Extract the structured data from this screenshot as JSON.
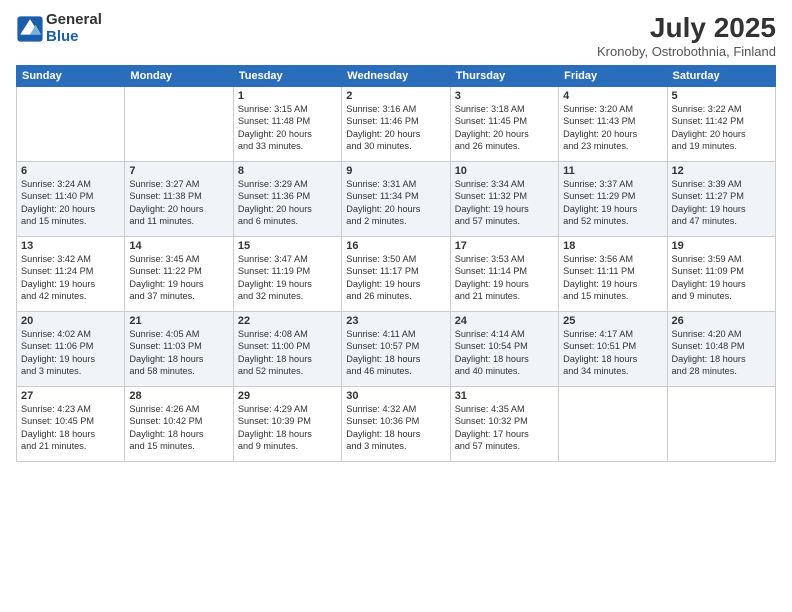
{
  "logo": {
    "general": "General",
    "blue": "Blue"
  },
  "title": "July 2025",
  "subtitle": "Kronoby, Ostrobothnia, Finland",
  "weekdays": [
    "Sunday",
    "Monday",
    "Tuesday",
    "Wednesday",
    "Thursday",
    "Friday",
    "Saturday"
  ],
  "weeks": [
    [
      {
        "day": "",
        "info": ""
      },
      {
        "day": "",
        "info": ""
      },
      {
        "day": "1",
        "info": "Sunrise: 3:15 AM\nSunset: 11:48 PM\nDaylight: 20 hours\nand 33 minutes."
      },
      {
        "day": "2",
        "info": "Sunrise: 3:16 AM\nSunset: 11:46 PM\nDaylight: 20 hours\nand 30 minutes."
      },
      {
        "day": "3",
        "info": "Sunrise: 3:18 AM\nSunset: 11:45 PM\nDaylight: 20 hours\nand 26 minutes."
      },
      {
        "day": "4",
        "info": "Sunrise: 3:20 AM\nSunset: 11:43 PM\nDaylight: 20 hours\nand 23 minutes."
      },
      {
        "day": "5",
        "info": "Sunrise: 3:22 AM\nSunset: 11:42 PM\nDaylight: 20 hours\nand 19 minutes."
      }
    ],
    [
      {
        "day": "6",
        "info": "Sunrise: 3:24 AM\nSunset: 11:40 PM\nDaylight: 20 hours\nand 15 minutes."
      },
      {
        "day": "7",
        "info": "Sunrise: 3:27 AM\nSunset: 11:38 PM\nDaylight: 20 hours\nand 11 minutes."
      },
      {
        "day": "8",
        "info": "Sunrise: 3:29 AM\nSunset: 11:36 PM\nDaylight: 20 hours\nand 6 minutes."
      },
      {
        "day": "9",
        "info": "Sunrise: 3:31 AM\nSunset: 11:34 PM\nDaylight: 20 hours\nand 2 minutes."
      },
      {
        "day": "10",
        "info": "Sunrise: 3:34 AM\nSunset: 11:32 PM\nDaylight: 19 hours\nand 57 minutes."
      },
      {
        "day": "11",
        "info": "Sunrise: 3:37 AM\nSunset: 11:29 PM\nDaylight: 19 hours\nand 52 minutes."
      },
      {
        "day": "12",
        "info": "Sunrise: 3:39 AM\nSunset: 11:27 PM\nDaylight: 19 hours\nand 47 minutes."
      }
    ],
    [
      {
        "day": "13",
        "info": "Sunrise: 3:42 AM\nSunset: 11:24 PM\nDaylight: 19 hours\nand 42 minutes."
      },
      {
        "day": "14",
        "info": "Sunrise: 3:45 AM\nSunset: 11:22 PM\nDaylight: 19 hours\nand 37 minutes."
      },
      {
        "day": "15",
        "info": "Sunrise: 3:47 AM\nSunset: 11:19 PM\nDaylight: 19 hours\nand 32 minutes."
      },
      {
        "day": "16",
        "info": "Sunrise: 3:50 AM\nSunset: 11:17 PM\nDaylight: 19 hours\nand 26 minutes."
      },
      {
        "day": "17",
        "info": "Sunrise: 3:53 AM\nSunset: 11:14 PM\nDaylight: 19 hours\nand 21 minutes."
      },
      {
        "day": "18",
        "info": "Sunrise: 3:56 AM\nSunset: 11:11 PM\nDaylight: 19 hours\nand 15 minutes."
      },
      {
        "day": "19",
        "info": "Sunrise: 3:59 AM\nSunset: 11:09 PM\nDaylight: 19 hours\nand 9 minutes."
      }
    ],
    [
      {
        "day": "20",
        "info": "Sunrise: 4:02 AM\nSunset: 11:06 PM\nDaylight: 19 hours\nand 3 minutes."
      },
      {
        "day": "21",
        "info": "Sunrise: 4:05 AM\nSunset: 11:03 PM\nDaylight: 18 hours\nand 58 minutes."
      },
      {
        "day": "22",
        "info": "Sunrise: 4:08 AM\nSunset: 11:00 PM\nDaylight: 18 hours\nand 52 minutes."
      },
      {
        "day": "23",
        "info": "Sunrise: 4:11 AM\nSunset: 10:57 PM\nDaylight: 18 hours\nand 46 minutes."
      },
      {
        "day": "24",
        "info": "Sunrise: 4:14 AM\nSunset: 10:54 PM\nDaylight: 18 hours\nand 40 minutes."
      },
      {
        "day": "25",
        "info": "Sunrise: 4:17 AM\nSunset: 10:51 PM\nDaylight: 18 hours\nand 34 minutes."
      },
      {
        "day": "26",
        "info": "Sunrise: 4:20 AM\nSunset: 10:48 PM\nDaylight: 18 hours\nand 28 minutes."
      }
    ],
    [
      {
        "day": "27",
        "info": "Sunrise: 4:23 AM\nSunset: 10:45 PM\nDaylight: 18 hours\nand 21 minutes."
      },
      {
        "day": "28",
        "info": "Sunrise: 4:26 AM\nSunset: 10:42 PM\nDaylight: 18 hours\nand 15 minutes."
      },
      {
        "day": "29",
        "info": "Sunrise: 4:29 AM\nSunset: 10:39 PM\nDaylight: 18 hours\nand 9 minutes."
      },
      {
        "day": "30",
        "info": "Sunrise: 4:32 AM\nSunset: 10:36 PM\nDaylight: 18 hours\nand 3 minutes."
      },
      {
        "day": "31",
        "info": "Sunrise: 4:35 AM\nSunset: 10:32 PM\nDaylight: 17 hours\nand 57 minutes."
      },
      {
        "day": "",
        "info": ""
      },
      {
        "day": "",
        "info": ""
      }
    ]
  ]
}
